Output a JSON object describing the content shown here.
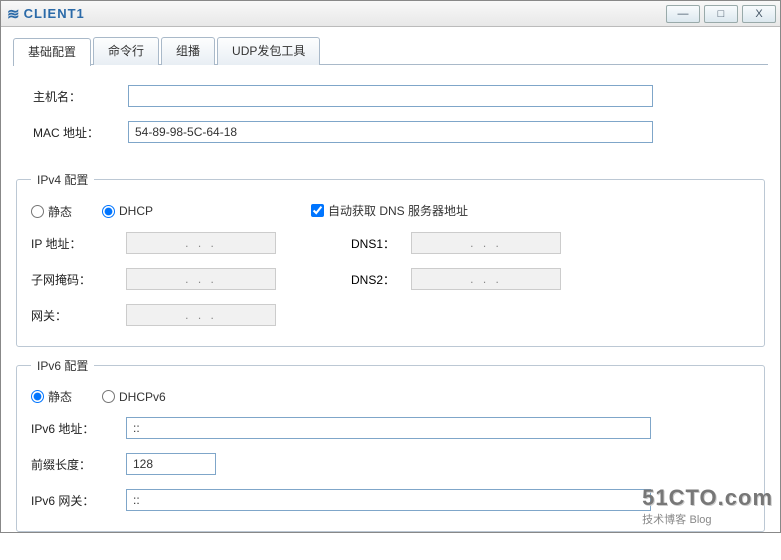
{
  "window": {
    "title": "CLIENT1"
  },
  "tabs": [
    "基础配置",
    "命令行",
    "组播",
    "UDP发包工具"
  ],
  "basic": {
    "host_label": "主机名：",
    "host_value": "",
    "mac_label": "MAC 地址：",
    "mac_value": "54-89-98-5C-64-18"
  },
  "ipv4": {
    "legend": "IPv4 配置",
    "radio_static": "静态",
    "radio_dhcp": "DHCP",
    "auto_dns": "自动获取 DNS 服务器地址",
    "ip_label": "IP 地址：",
    "mask_label": "子网掩码：",
    "gw_label": "网关：",
    "dns1_label": "DNS1：",
    "dns2_label": "DNS2：",
    "dots": ".       .       ."
  },
  "ipv6": {
    "legend": "IPv6 配置",
    "radio_static": "静态",
    "radio_dhcpv6": "DHCPv6",
    "addr_label": "IPv6 地址：",
    "addr_value": "::",
    "prefix_label": "前缀长度：",
    "prefix_value": "128",
    "gw_label": "IPv6 网关：",
    "gw_value": "::"
  },
  "watermark": {
    "big": "51CTO.com",
    "sm1": "技术博客",
    "sm2": "Blog"
  }
}
